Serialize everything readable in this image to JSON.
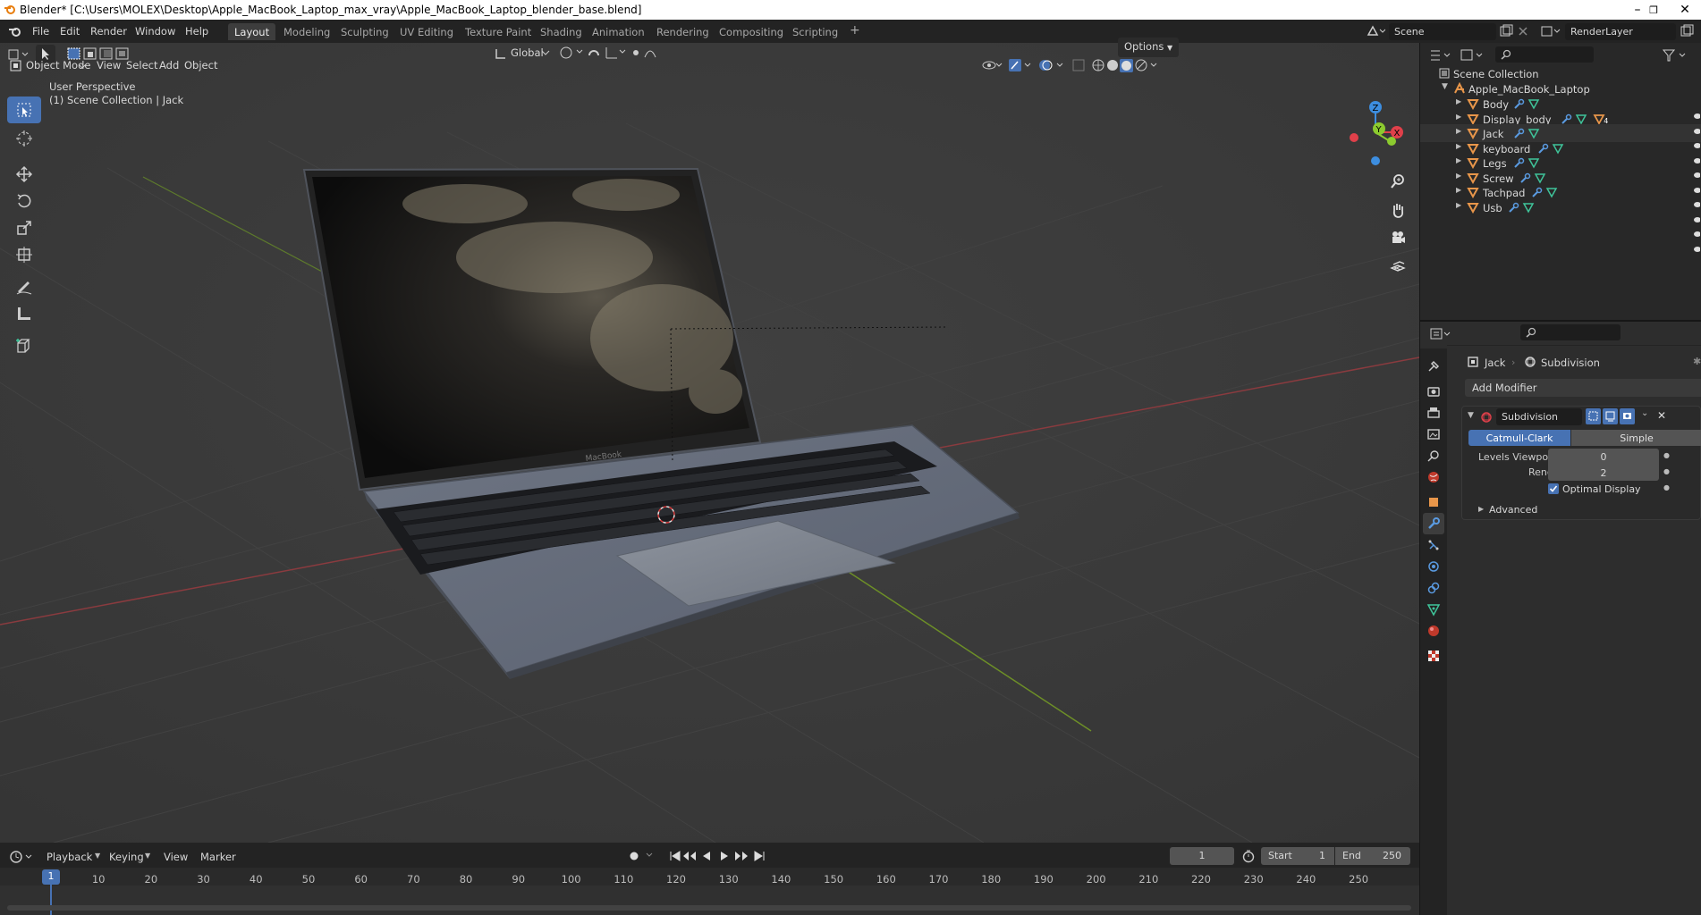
{
  "window": {
    "title": "Blender* [C:\\Users\\MOLEX\\Desktop\\Apple_MacBook_Laptop_max_vray\\Apple_MacBook_Laptop_blender_base.blend]",
    "minimize": "–",
    "restore": "❐",
    "close": "✕"
  },
  "menu": {
    "items": [
      "File",
      "Edit",
      "Render",
      "Window",
      "Help"
    ],
    "workspaces": [
      "Layout",
      "Modeling",
      "Sculpting",
      "UV Editing",
      "Texture Paint",
      "Shading",
      "Animation",
      "Rendering",
      "Compositing",
      "Scripting"
    ],
    "add_workspace": "+",
    "scene": "Scene",
    "view_layer": "RenderLayer"
  },
  "viewport": {
    "mode": "Object Mode",
    "menus": [
      "View",
      "Select",
      "Add",
      "Object"
    ],
    "orientation": "Global",
    "options": "Options",
    "overlay_title": "User Perspective",
    "overlay_subtitle": "(1) Scene Collection | Jack",
    "gizmo": {
      "x": "X",
      "y": "Y",
      "z": "Z"
    },
    "laptop_logo": "MacBook"
  },
  "outliner": {
    "root": "Scene Collection",
    "collection": "Apple_MacBook_Laptop",
    "objects": [
      "Body",
      "Display_body",
      "Jack",
      "keyboard",
      "Legs",
      "Screw",
      "Tachpad",
      "Usb"
    ],
    "display_body_badge": "4"
  },
  "properties": {
    "breadcrumb_object": "Jack",
    "breadcrumb_modifier": "Subdivision",
    "add_modifier": "Add Modifier",
    "modifier_name": "Subdivision",
    "type_options": [
      "Catmull-Clark",
      "Simple"
    ],
    "levels_viewport_label": "Levels Viewport",
    "levels_viewport": "0",
    "render_label": "Render",
    "render": "2",
    "optimal_display": "Optimal Display",
    "advanced": "Advanced"
  },
  "timeline": {
    "menus": [
      "Playback",
      "Keying",
      "View",
      "Marker"
    ],
    "current_frame": "1",
    "start_label": "Start",
    "start": "1",
    "end_label": "End",
    "end": "250",
    "ruler": [
      "10",
      "20",
      "30",
      "40",
      "50",
      "60",
      "70",
      "80",
      "90",
      "100",
      "110",
      "120",
      "130",
      "140",
      "150",
      "160",
      "170",
      "180",
      "190",
      "200",
      "210",
      "220",
      "230",
      "240",
      "250"
    ],
    "playhead": "1"
  },
  "colors": {
    "accent": "#4772b3",
    "x_axis": "#e0404a",
    "y_axis": "#8ccb2f",
    "z_axis": "#3d8ee0",
    "object_orange": "#e8964a",
    "mesh_green": "#3fc49a"
  }
}
